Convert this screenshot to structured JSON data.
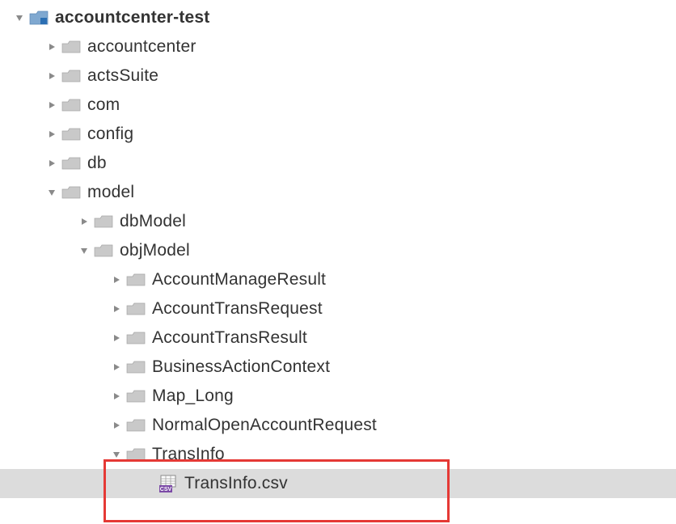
{
  "tree": {
    "root": {
      "name": "accountcenter-test"
    },
    "accountcenter": {
      "name": "accountcenter"
    },
    "actsSuite": {
      "name": "actsSuite"
    },
    "com": {
      "name": "com"
    },
    "config": {
      "name": "config"
    },
    "db": {
      "name": "db"
    },
    "model": {
      "name": "model"
    },
    "dbModel": {
      "name": "dbModel"
    },
    "objModel": {
      "name": "objModel"
    },
    "accountManageResult": {
      "name": "AccountManageResult"
    },
    "accountTransRequest": {
      "name": "AccountTransRequest"
    },
    "accountTransResult": {
      "name": "AccountTransResult"
    },
    "businessActionContext": {
      "name": "BusinessActionContext"
    },
    "mapLong": {
      "name": "Map_Long"
    },
    "normalOpenAccountRequest": {
      "name": "NormalOpenAccountRequest"
    },
    "transInfo": {
      "name": "TransInfo"
    },
    "transInfoCsv": {
      "name": "TransInfo.csv"
    }
  }
}
